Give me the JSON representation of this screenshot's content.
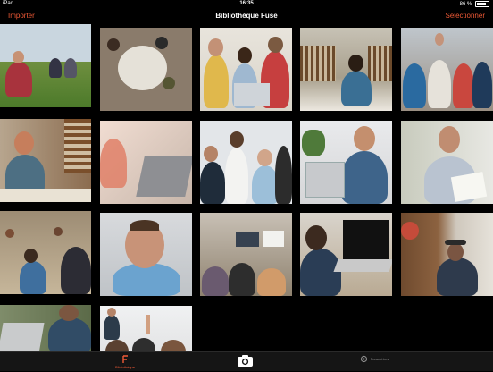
{
  "status": {
    "carrier": "iPad",
    "time": "16:35",
    "battery": "86 %"
  },
  "nav": {
    "left": "Importer",
    "title": "Bibliothèque Fuse",
    "right": "Sélectionner"
  },
  "tabs": {
    "library": "Bibliothèque",
    "settings": "Paramètres"
  },
  "colors": {
    "accent": "#f05a36",
    "background": "#000000",
    "tabbar": "#151515"
  },
  "tiles": [
    {
      "name": "students-on-lawn"
    },
    {
      "name": "team-table-overhead"
    },
    {
      "name": "students-with-laptop"
    },
    {
      "name": "student-in-library"
    },
    {
      "name": "team-high-five"
    },
    {
      "name": "woman-reading-books"
    },
    {
      "name": "hands-on-laptop"
    },
    {
      "name": "group-meeting"
    },
    {
      "name": "man-with-headset"
    },
    {
      "name": "man-reading-paper"
    },
    {
      "name": "lecture-hall-students"
    },
    {
      "name": "man-selfie-portrait"
    },
    {
      "name": "classroom-presentation"
    },
    {
      "name": "man-typing-laptop"
    },
    {
      "name": "man-with-hat"
    },
    {
      "name": "student-partial"
    },
    {
      "name": "teacher-raised-hand"
    }
  ]
}
